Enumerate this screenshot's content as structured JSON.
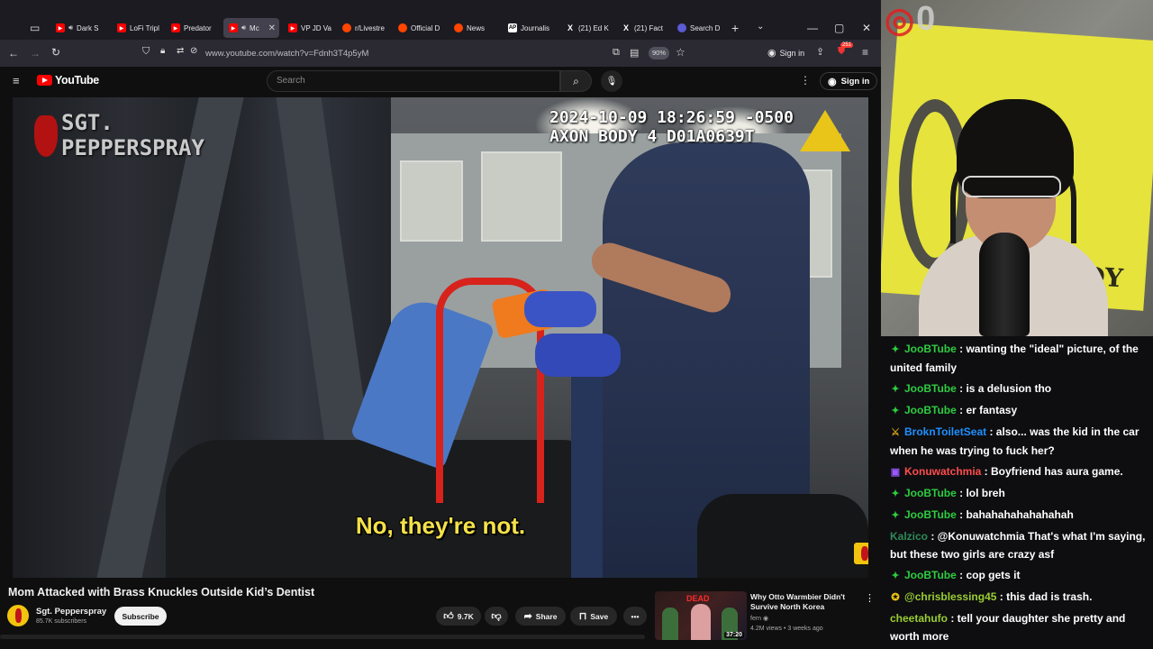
{
  "browser": {
    "tabs": [
      {
        "label": "Dark S",
        "favicon": "youtube-favicon",
        "active": false,
        "audio": true
      },
      {
        "label": "LoFi Tripl",
        "favicon": "youtube-favicon",
        "active": false,
        "audio": false
      },
      {
        "label": "Predator",
        "favicon": "youtube-favicon",
        "active": false,
        "audio": false
      },
      {
        "label": "Mc",
        "favicon": "youtube-favicon",
        "active": true,
        "audio": true
      },
      {
        "label": "VP JD Va",
        "favicon": "youtube-favicon",
        "active": false,
        "audio": false
      },
      {
        "label": "r/Livestre",
        "favicon": "reddit-favicon",
        "active": false,
        "audio": false
      },
      {
        "label": "Official D",
        "favicon": "reddit-favicon",
        "active": false,
        "audio": false
      },
      {
        "label": "News",
        "favicon": "reddit-favicon",
        "active": false,
        "audio": false
      },
      {
        "label": "Journalis",
        "favicon": "ap-favicon",
        "active": false,
        "audio": false
      },
      {
        "label": "(21) Ed K",
        "favicon": "x-favicon",
        "active": false,
        "audio": false
      },
      {
        "label": "(21) Fact",
        "favicon": "x-favicon",
        "active": false,
        "audio": false
      },
      {
        "label": "Search D",
        "favicon": "search-favicon",
        "active": false,
        "audio": false
      }
    ],
    "url": "www.youtube.com/watch?v=Fdnh3T4p5yM",
    "zoom": "90%",
    "sign_in": "Sign in",
    "notification_count": "251"
  },
  "youtube": {
    "logo_text": "YouTube",
    "search_placeholder": "Search",
    "sign_in": "Sign in"
  },
  "video": {
    "timestamp_line1": "2024-10-09 18:26:59 -0500",
    "timestamp_line2": "AXON BODY 4 D01A0639T",
    "watermark_line1": "SGT.",
    "watermark_line2": "PEPPERSPRAY",
    "subtitle": "No, they're not.",
    "title": "Mom Attacked with Brass Knuckles Outside Kid’s Dentist",
    "channel": "Sgt. Pepperspray",
    "subscribers": "85.7K subscribers",
    "subscribe_label": "Subscribe",
    "likes": "9.7K",
    "share_label": "Share",
    "save_label": "Save"
  },
  "recommended": {
    "thumb_text": "DEAD",
    "duration": "37:20",
    "title": "Why Otto Warmbier Didn't Survive North Korea",
    "channel": "fern",
    "meta": "4.2M views • 3 weeks ago"
  },
  "stream": {
    "flag_text": "ODY",
    "badge_text": "0"
  },
  "chat": [
    {
      "badge": "✦",
      "badge_color": "#2ecc40",
      "user": "JooBTube",
      "color": "#2ecc40",
      "text": " : wanting the \"ideal\" picture, of the united family"
    },
    {
      "badge": "✦",
      "badge_color": "#2ecc40",
      "user": "JooBTube",
      "color": "#2ecc40",
      "text": " : is a delusion tho"
    },
    {
      "badge": "✦",
      "badge_color": "#2ecc40",
      "user": "JooBTube",
      "color": "#2ecc40",
      "text": " : er fantasy"
    },
    {
      "badge": "⚔",
      "badge_color": "#d4a017",
      "user": "BroknToiletSeat",
      "color": "#1e90ff",
      "text": " : also... was the kid in the car when he was trying to fuck her?"
    },
    {
      "badge": "▣",
      "badge_color": "#9b59ff",
      "user": "Konuwatchmia",
      "color": "#ff4c4c",
      "text": " : Boyfriend has aura game."
    },
    {
      "badge": "✦",
      "badge_color": "#2ecc40",
      "user": "JooBTube",
      "color": "#2ecc40",
      "text": " : lol breh"
    },
    {
      "badge": "✦",
      "badge_color": "#2ecc40",
      "user": "JooBTube",
      "color": "#2ecc40",
      "text": " : bahahahahahahahah"
    },
    {
      "badge": "",
      "badge_color": "#2ecc40",
      "user": "Kalzico",
      "color": "#2e8b57",
      "text": " : @Konuwatchmia That's what I'm saying, but these two girls are crazy asf"
    },
    {
      "badge": "✦",
      "badge_color": "#2ecc40",
      "user": "JooBTube",
      "color": "#2ecc40",
      "text": " : cop gets it"
    },
    {
      "badge": "✪",
      "badge_color": "#f1c40f",
      "user": "@chrisblessing45",
      "color": "#9acd32",
      "text": " : this dad is trash."
    },
    {
      "badge": "",
      "badge_color": "#2ecc40",
      "user": "cheetahufo",
      "color": "#9acd32",
      "text": " : tell your daughter she pretty and worth more"
    }
  ]
}
